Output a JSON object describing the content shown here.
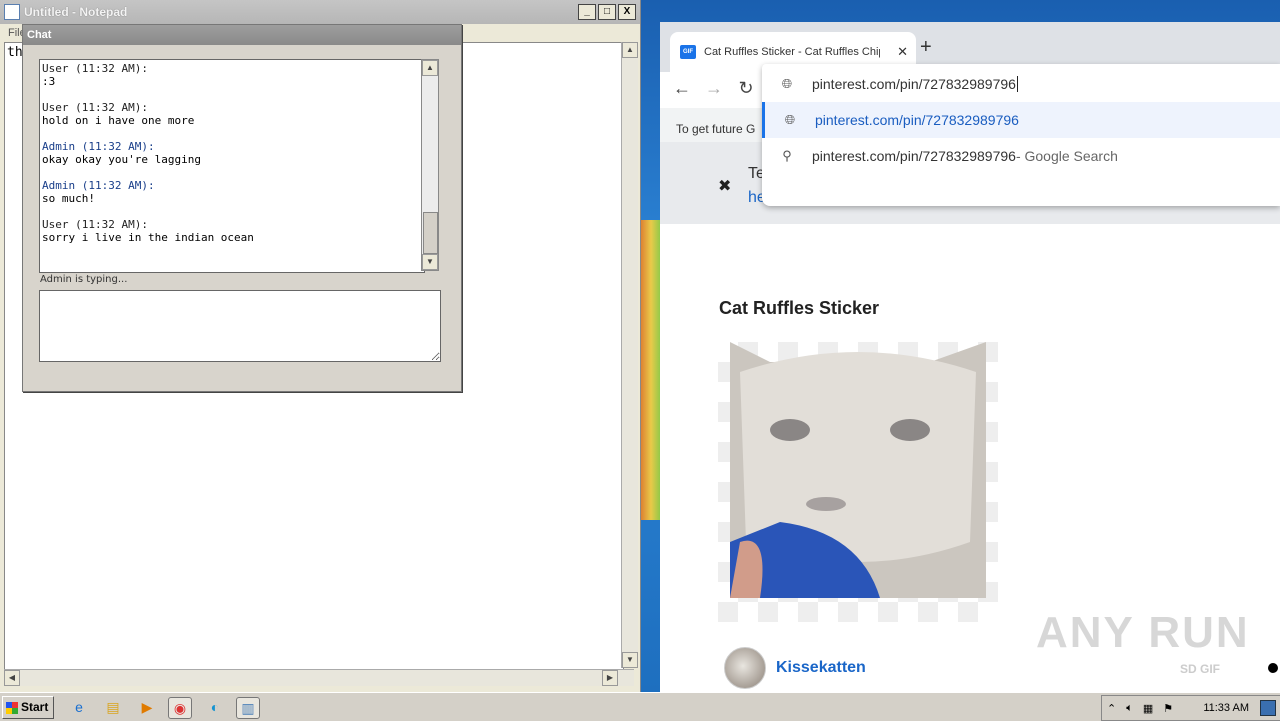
{
  "notepad": {
    "title": "Untitled - Notepad",
    "menu_file": "File",
    "content": "th",
    "minimize": "_",
    "maximize": "□",
    "close": "X"
  },
  "chat": {
    "title": "Chat",
    "messages": [
      {
        "sender": "User (11:32 AM):",
        "text": ":3",
        "role": "user"
      },
      {
        "sender": "User (11:32 AM):",
        "text": "hold on i have one more",
        "role": "user"
      },
      {
        "sender": "Admin (11:32 AM):",
        "text": "okay okay you're lagging",
        "role": "admin"
      },
      {
        "sender": "Admin (11:32 AM):",
        "text": "so much!",
        "role": "admin"
      },
      {
        "sender": "User (11:32 AM):",
        "text": "sorry i live in the indian ocean",
        "role": "user"
      }
    ],
    "typing_status": "Admin is typing..."
  },
  "browser": {
    "tab_title": "Cat Ruffles Sticker - Cat Ruffles Chip",
    "tab_favicon": "GIF",
    "new_tab": "+",
    "omnibox_text": "pinterest.com/pin/727832989796",
    "suggestions": [
      {
        "label": "pinterest.com/pin/727832989796",
        "hint": ""
      },
      {
        "label": "pinterest.com/pin/727832989796",
        "hint": " - Google Search"
      }
    ],
    "infobar_text": "To get future G",
    "notice_text": "Te",
    "notice_link": "here",
    "page_title": "Cat Ruffles Sticker",
    "author": "Kissekatten",
    "sd_gif": "SD GIF",
    "accent": "#1a73e8"
  },
  "watermark": "ANY RUN",
  "taskbar": {
    "start": "Start",
    "clock": "11:33 AM"
  }
}
